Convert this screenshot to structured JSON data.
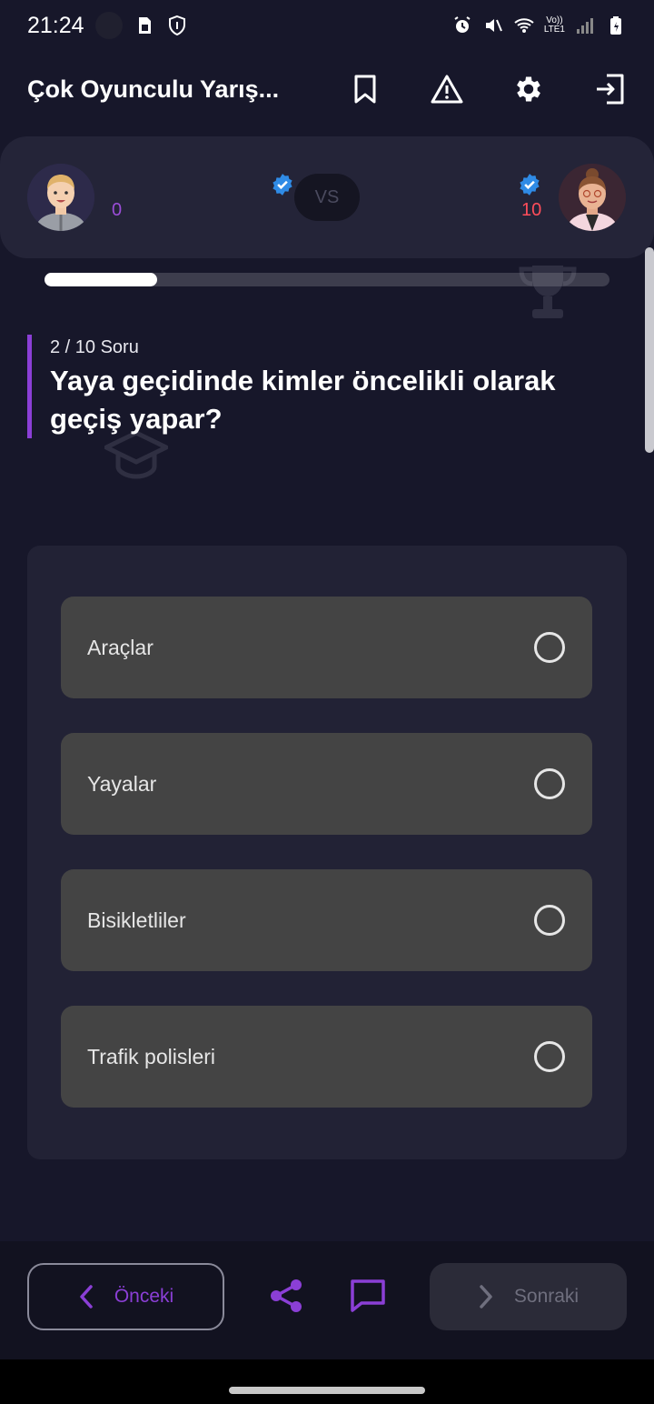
{
  "status_bar": {
    "time": "21:24",
    "network_label_top": "Vo))",
    "network_label_bottom": "LTE1",
    "wifi_badge": "6"
  },
  "app_bar": {
    "title": "Çok Oyunculu Yarış...",
    "actions": [
      "bookmark-icon",
      "warning-icon",
      "settings-icon",
      "exit-icon"
    ]
  },
  "match": {
    "left_player": {
      "score": "0",
      "verified": true
    },
    "right_player": {
      "score": "10",
      "verified": true
    },
    "vs_label": "VS",
    "progress_fraction": 0.2
  },
  "question": {
    "counter": "2 / 10 Soru",
    "text": "Yaya geçidinde kimler öncelikli olarak geçiş yapar?"
  },
  "answers": [
    {
      "label": "Araçlar",
      "selected": false
    },
    {
      "label": "Yayalar",
      "selected": false
    },
    {
      "label": "Bisikletliler",
      "selected": false
    },
    {
      "label": "Trafik polisleri",
      "selected": false
    }
  ],
  "bottom_bar": {
    "prev_label": "Önceki",
    "next_label": "Sonraki"
  },
  "colors": {
    "accent": "#8b3fd6",
    "left_score": "#9b4dd8",
    "right_score": "#ff4d5a",
    "verified": "#2f8be6"
  }
}
